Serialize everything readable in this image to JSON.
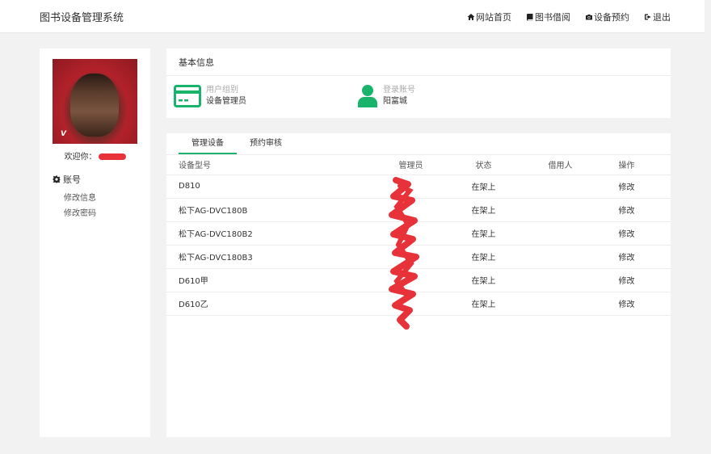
{
  "app": {
    "brand": "图书设备管理系统"
  },
  "nav": [
    {
      "label": "网站首页",
      "icon": "home-icon"
    },
    {
      "label": "图书借阅",
      "icon": "book-icon"
    },
    {
      "label": "设备预约",
      "icon": "camera-icon"
    },
    {
      "label": "退出",
      "icon": "sign-out-icon"
    }
  ],
  "sidebar": {
    "avatar_logo": "V",
    "welcome": "欢迎你：",
    "menu_title": "账号",
    "menu_icon": "gear-icon",
    "links": [
      "修改信息",
      "修改密码"
    ]
  },
  "basic_info": {
    "title": "基本信息",
    "group_label": "用户组别",
    "group_value": "设备管理员",
    "account_label": "登录账号",
    "account_value": "阳富城",
    "colors": {
      "accent": "#19b36b"
    }
  },
  "devices": {
    "tabs": [
      "管理设备",
      "预约审核"
    ],
    "columns": [
      "设备型号",
      "管理员",
      "状态",
      "借用人",
      "操作"
    ],
    "rows": [
      {
        "model": "D810",
        "admin": "",
        "status": "在架上",
        "borrower": "",
        "action": "修改"
      },
      {
        "model": "松下AG-DVC180B",
        "admin": "",
        "status": "在架上",
        "borrower": "",
        "action": "修改"
      },
      {
        "model": "松下AG-DVC180B2",
        "admin": "",
        "status": "在架上",
        "borrower": "",
        "action": "修改"
      },
      {
        "model": "松下AG-DVC180B3",
        "admin": "",
        "status": "在架上",
        "borrower": "",
        "action": "修改"
      },
      {
        "model": "D610甲",
        "admin": "",
        "status": "在架上",
        "borrower": "",
        "action": "修改"
      },
      {
        "model": "D610乙",
        "admin": "",
        "status": "在架上",
        "borrower": "",
        "action": "修改"
      }
    ]
  }
}
